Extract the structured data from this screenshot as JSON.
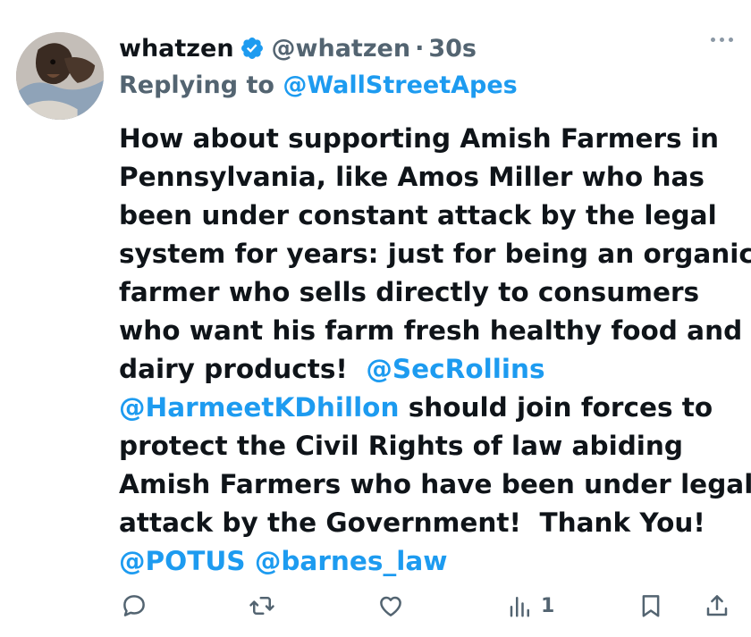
{
  "author": {
    "name": "whatzen",
    "handle": "@whatzen",
    "separator": "·",
    "time": "30s"
  },
  "reply": {
    "prefix": "Replying to ",
    "mention": "@WallStreetApes"
  },
  "body": {
    "lines": [
      "How about supporting Amish Farmers in",
      "Pennsylvania, like Amos Miller who has",
      "been under constant attack by the legal",
      "system for years: just for being an organic",
      "farmer who sells directly to consumers",
      "who want his farm fresh healthy food and",
      "dairy products!  "
    ],
    "mention_secrollins": "@SecRollins",
    "mention_harmeet": "@HarmeetKDhillon",
    "after_harmeet": " should join forces to",
    "lines2": [
      "protect the Civil Rights of law abiding",
      "Amish Farmers who have been under legal",
      "attack by the Government!  Thank You!"
    ],
    "mention_potus": "@POTUS",
    "mention_barnes": "@barnes_law"
  },
  "actions": {
    "views_count": "1"
  },
  "colors": {
    "accent": "#1d9bf0",
    "secondary": "#536471",
    "text": "#0f1419"
  },
  "icons": [
    "verified-badge-icon",
    "more-icon",
    "reply-icon",
    "retweet-icon",
    "like-icon",
    "views-icon",
    "bookmark-icon",
    "share-icon"
  ]
}
